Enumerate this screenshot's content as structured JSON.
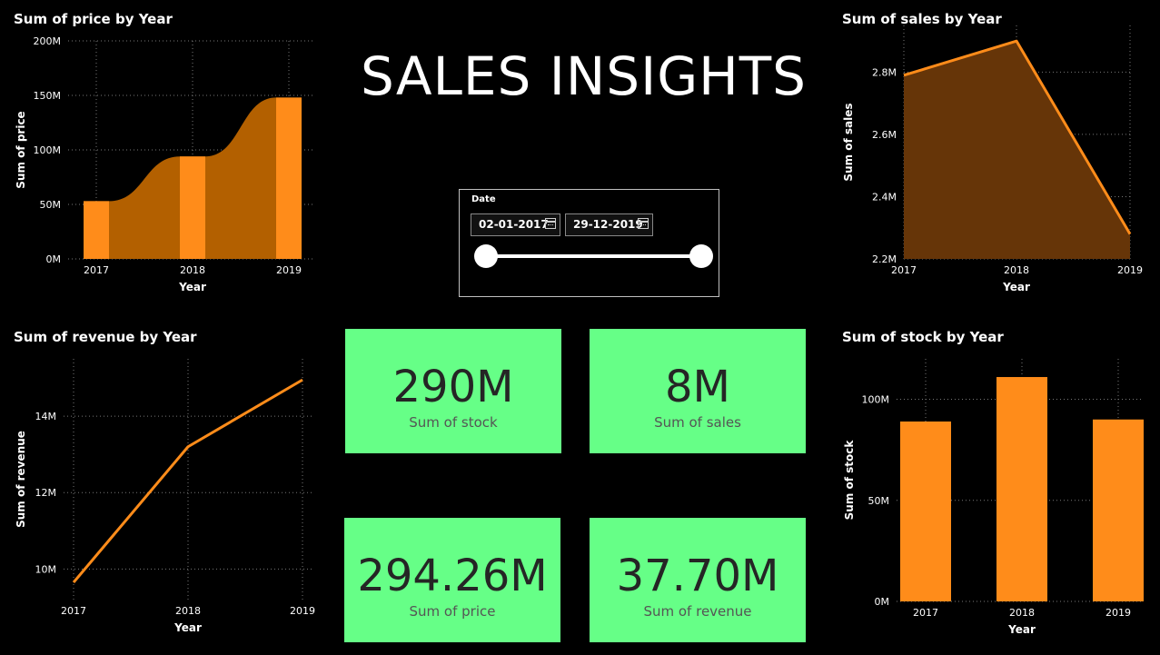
{
  "dashboard": {
    "title": "SALES INSIGHTS",
    "slicer": {
      "label": "Date",
      "start_date": "02-01-2017",
      "end_date": "29-12-2019"
    },
    "cards": [
      {
        "value": "290M",
        "caption": "Sum of stock"
      },
      {
        "value": "8M",
        "caption": "Sum of sales"
      },
      {
        "value": "294.26M",
        "caption": "Sum of price"
      },
      {
        "value": "37.70M",
        "caption": "Sum of revenue"
      }
    ]
  },
  "colors": {
    "background": "#000000",
    "series": "#ff8c1a",
    "card": "#66ff87",
    "area_fill": "#b36000"
  },
  "chart_data": [
    {
      "id": "price",
      "type": "bar",
      "title": "Sum of price by Year",
      "xlabel": "Year",
      "ylabel": "Sum of price",
      "categories": [
        "2017",
        "2018",
        "2019"
      ],
      "values": [
        53,
        94,
        148
      ],
      "ylim": [
        0,
        200
      ],
      "yticks": [
        "0M",
        "50M",
        "100M",
        "150M",
        "200M"
      ],
      "grid": true
    },
    {
      "id": "sales",
      "type": "area",
      "title": "Sum of sales by Year",
      "xlabel": "Year",
      "ylabel": "Sum of sales",
      "categories": [
        "2017",
        "2018",
        "2019"
      ],
      "values": [
        2.79,
        2.9,
        2.28
      ],
      "ylim": [
        2.2,
        2.95
      ],
      "yticks": [
        "2.2M",
        "2.4M",
        "2.6M",
        "2.8M"
      ],
      "grid": true
    },
    {
      "id": "revenue",
      "type": "line",
      "title": "Sum of revenue by Year",
      "xlabel": "Year",
      "ylabel": "Sum of revenue",
      "categories": [
        "2017",
        "2018",
        "2019"
      ],
      "values": [
        9.65,
        13.2,
        14.95
      ],
      "ylim": [
        9.2,
        15.5
      ],
      "yticks": [
        "10M",
        "12M",
        "14M"
      ],
      "grid": true
    },
    {
      "id": "stock",
      "type": "bar",
      "title": "Sum of stock by Year",
      "xlabel": "Year",
      "ylabel": "Sum of stock",
      "categories": [
        "2017",
        "2018",
        "2019"
      ],
      "values": [
        89,
        111,
        90
      ],
      "ylim": [
        0,
        120
      ],
      "yticks": [
        "0M",
        "50M",
        "100M"
      ],
      "grid": true
    }
  ]
}
